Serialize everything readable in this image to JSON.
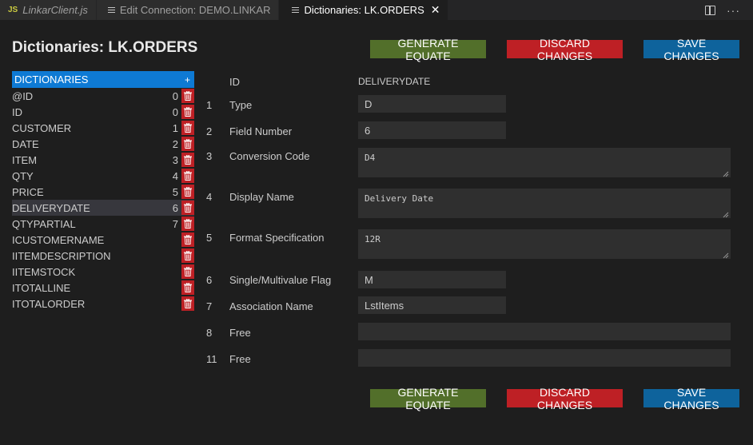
{
  "tabs": [
    {
      "badge": "JS",
      "label": "LinkarClient.js",
      "active": false
    },
    {
      "label": "Edit Connection: DEMO.LINKAR",
      "active": false
    },
    {
      "label": "Dictionaries: LK.ORDERS",
      "active": true,
      "close": "✕"
    }
  ],
  "tab_actions": {
    "more": "···"
  },
  "page": {
    "title": "Dictionaries: LK.ORDERS"
  },
  "buttons": {
    "generate": "GENERATE EQUATE",
    "discard": "DISCARD CHANGES",
    "save": "SAVE CHANGES"
  },
  "colors": {
    "green": "#526f2a",
    "red": "#be2025",
    "blue": "#0e639c",
    "selected_header": "#0e7ad4"
  },
  "sidebar": {
    "header": "DICTIONARIES",
    "add": "+",
    "items": [
      {
        "name": "@ID",
        "num": "0"
      },
      {
        "name": "ID",
        "num": "0"
      },
      {
        "name": "CUSTOMER",
        "num": "1"
      },
      {
        "name": "DATE",
        "num": "2"
      },
      {
        "name": "ITEM",
        "num": "3"
      },
      {
        "name": "QTY",
        "num": "4"
      },
      {
        "name": "PRICE",
        "num": "5"
      },
      {
        "name": "DELIVERYDATE",
        "num": "6",
        "selected": true
      },
      {
        "name": "QTYPARTIAL",
        "num": "7"
      },
      {
        "name": "ICUSTOMERNAME",
        "num": ""
      },
      {
        "name": "IITEMDESCRIPTION",
        "num": ""
      },
      {
        "name": "IITEMSTOCK",
        "num": ""
      },
      {
        "name": "ITOTALLINE",
        "num": ""
      },
      {
        "name": "ITOTALORDER",
        "num": ""
      }
    ]
  },
  "form": {
    "id_label": "ID",
    "id_value": "DELIVERYDATE",
    "fields": [
      {
        "idx": "1",
        "label": "Type",
        "value": "D"
      },
      {
        "idx": "2",
        "label": "Field Number",
        "value": "6"
      },
      {
        "idx": "3",
        "label": "Conversion Code",
        "value": "D4"
      },
      {
        "idx": "4",
        "label": "Display Name",
        "value": "Delivery Date"
      },
      {
        "idx": "5",
        "label": "Format Specification",
        "value": "12R"
      },
      {
        "idx": "6",
        "label": "Single/Multivalue Flag",
        "value": "M"
      },
      {
        "idx": "7",
        "label": "Association Name",
        "value": "LstItems"
      },
      {
        "idx": "8",
        "label": "Free",
        "value": ""
      },
      {
        "idx": "11",
        "label": "Free",
        "value": ""
      }
    ]
  }
}
